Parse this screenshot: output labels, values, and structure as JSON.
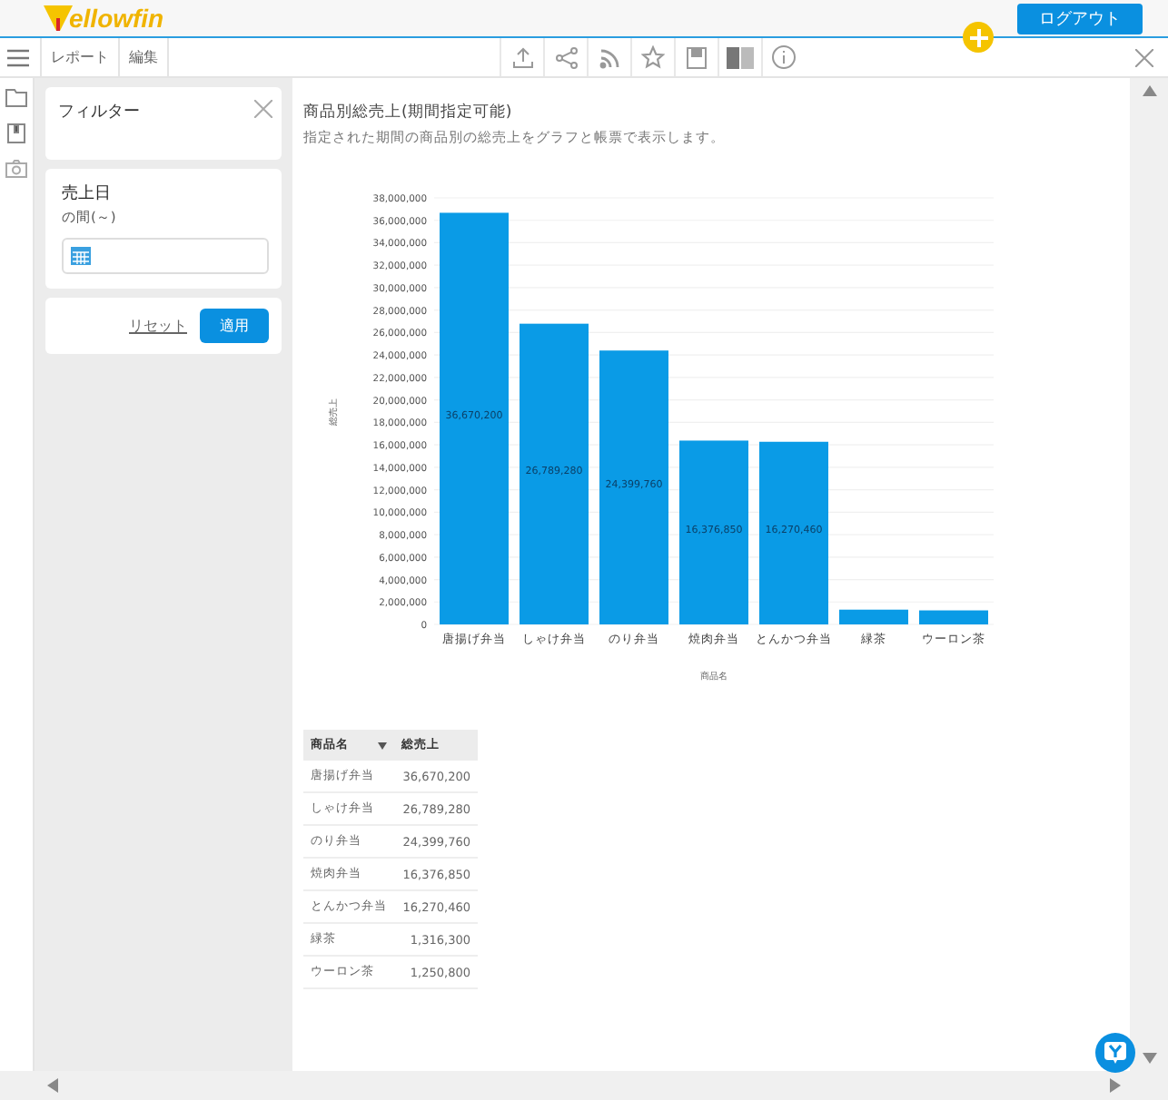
{
  "header": {
    "logo": "ellowfin",
    "logout_button": "ログアウト"
  },
  "toolbar": {
    "tabs": [
      "レポート",
      "編集"
    ]
  },
  "filter_panel": {
    "title": "フィルター",
    "field": {
      "label": "売上日",
      "hint": "の間(～)"
    },
    "reset": "リセット",
    "apply": "適用"
  },
  "report": {
    "title": "商品別総売上(期間指定可能)",
    "description": "指定された期間の商品別の総売上をグラフと帳票で表示します。",
    "chart_data": {
      "type": "bar",
      "xlabel": "商品名",
      "ylabel": "総売上",
      "grid": true,
      "categories": [
        "唐揚げ弁当",
        "しゃけ弁当",
        "のり弁当",
        "焼肉弁当",
        "とんかつ弁当",
        "緑茶",
        "ウーロン茶"
      ],
      "values": [
        36670200,
        26789280,
        24399760,
        16376850,
        16270460,
        1316300,
        1250800
      ],
      "value_labels": [
        "36,670,200",
        "26,789,280",
        "24,399,760",
        "16,376,850",
        "16,270,460",
        null,
        null
      ],
      "ylim": [
        0,
        38000000
      ],
      "yticks": [
        {
          "value": 0,
          "label": "0"
        },
        {
          "value": 2000000,
          "label": "2,000,000"
        },
        {
          "value": 4000000,
          "label": "4,000,000"
        },
        {
          "value": 6000000,
          "label": "6,000,000"
        },
        {
          "value": 8000000,
          "label": "8,000,000"
        },
        {
          "value": 10000000,
          "label": "10,000,000"
        },
        {
          "value": 12000000,
          "label": "12,000,000"
        },
        {
          "value": 14000000,
          "label": "14,000,000"
        },
        {
          "value": 16000000,
          "label": "16,000,000"
        },
        {
          "value": 18000000,
          "label": "18,000,000"
        },
        {
          "value": 20000000,
          "label": "20,000,000"
        },
        {
          "value": 22000000,
          "label": "22,000,000"
        },
        {
          "value": 24000000,
          "label": "24,000,000"
        },
        {
          "value": 26000000,
          "label": "26,000,000"
        },
        {
          "value": 28000000,
          "label": "28,000,000"
        },
        {
          "value": 30000000,
          "label": "30,000,000"
        },
        {
          "value": 32000000,
          "label": "32,000,000"
        },
        {
          "value": 34000000,
          "label": "34,000,000"
        },
        {
          "value": 36000000,
          "label": "36,000,000"
        },
        {
          "value": 38000000,
          "label": "38,000,000"
        }
      ]
    },
    "table": {
      "columns": [
        "商品名",
        "総売上"
      ],
      "rows": [
        [
          "唐揚げ弁当",
          "36,670,200"
        ],
        [
          "しゃけ弁当",
          "26,789,280"
        ],
        [
          "のり弁当",
          "24,399,760"
        ],
        [
          "焼肉弁当",
          "16,376,850"
        ],
        [
          "とんかつ弁当",
          "16,270,460"
        ],
        [
          "緑茶",
          "1,316,300"
        ],
        [
          "ウーロン茶",
          "1,250,800"
        ]
      ]
    }
  }
}
